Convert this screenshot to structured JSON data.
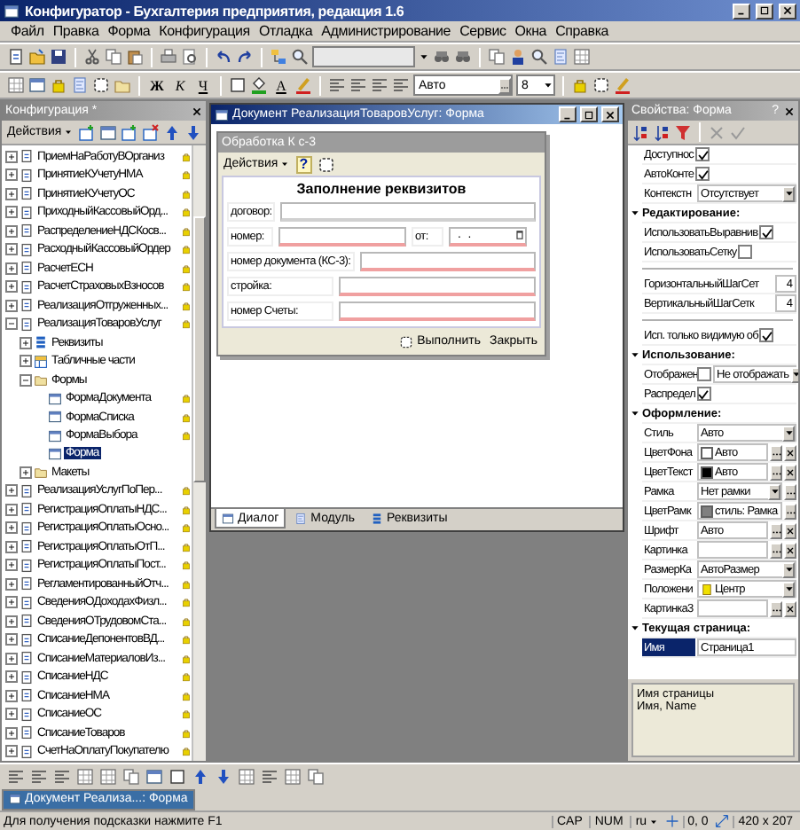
{
  "window": {
    "title": "Конфигуратор - Бухгалтерия предприятия, редакция 1.6"
  },
  "menu": [
    "Файл",
    "Правка",
    "Форма",
    "Конфигурация",
    "Отладка",
    "Администрирование",
    "Сервис",
    "Окна",
    "Справка"
  ],
  "format_toolbar": {
    "bold": "Ж",
    "italic": "К",
    "underline": "Ч",
    "text_color": "A",
    "font": "Авто",
    "size": "8"
  },
  "config_panel": {
    "title": "Конфигурация *",
    "actions": "Действия",
    "tree": [
      {
        "label": "ПриемНаРаботуВОрганиз",
        "kind": "document",
        "expanded": false,
        "selected": false,
        "captured": true
      },
      {
        "label": "ПринятиеКУчетуНМА",
        "kind": "document",
        "expanded": false,
        "selected": false,
        "captured": true
      },
      {
        "label": "ПринятиеКУчетуОС",
        "kind": "document",
        "expanded": false,
        "selected": false,
        "captured": true
      },
      {
        "label": "ПриходныйКассовыйОрд...",
        "kind": "document",
        "expanded": false,
        "selected": false,
        "captured": true
      },
      {
        "label": "РаспределениеНДСКосв...",
        "kind": "document",
        "expanded": false,
        "selected": false,
        "captured": true
      },
      {
        "label": "РасходныйКассовыйОрдер",
        "kind": "document",
        "expanded": false,
        "selected": false,
        "captured": true
      },
      {
        "label": "РасчетЕСН",
        "kind": "document",
        "expanded": false,
        "selected": false,
        "captured": true
      },
      {
        "label": "РасчетСтраховыхВзносов",
        "kind": "document",
        "expanded": false,
        "selected": false,
        "captured": true
      },
      {
        "label": "РеализацияОтгруженных...",
        "kind": "document",
        "expanded": false,
        "selected": false,
        "captured": true
      },
      {
        "label": "РеализацияТоваровУслуг",
        "kind": "document",
        "expanded": true,
        "selected": false,
        "captured": true,
        "children": [
          {
            "label": "Реквизиты",
            "kind": "attributes",
            "expanded": false,
            "selected": false,
            "captured": false
          },
          {
            "label": "Табличные части",
            "kind": "tables",
            "expanded": false,
            "selected": false,
            "captured": false
          },
          {
            "label": "Формы",
            "kind": "forms",
            "expanded": true,
            "selected": false,
            "captured": false,
            "children": [
              {
                "label": "ФормаДокумента",
                "kind": "form",
                "selected": false,
                "captured": true
              },
              {
                "label": "ФормаСписка",
                "kind": "form",
                "selected": false,
                "captured": true
              },
              {
                "label": "ФормаВыбора",
                "kind": "form",
                "selected": false,
                "captured": true
              },
              {
                "label": "Форма",
                "kind": "form",
                "selected": true,
                "captured": false
              }
            ]
          },
          {
            "label": "Макеты",
            "kind": "templates",
            "expanded": false,
            "selected": false,
            "captured": false
          }
        ]
      },
      {
        "label": "РеализацияУслугПоПер...",
        "kind": "document",
        "expanded": false,
        "selected": false,
        "captured": true
      },
      {
        "label": "РегистрацияОплатыНДС...",
        "kind": "document",
        "expanded": false,
        "selected": false,
        "captured": true
      },
      {
        "label": "РегистрацияОплатыОсно...",
        "kind": "document",
        "expanded": false,
        "selected": false,
        "captured": true
      },
      {
        "label": "РегистрацияОплатыОтП...",
        "kind": "document",
        "expanded": false,
        "selected": false,
        "captured": true
      },
      {
        "label": "РегистрацияОплатыПост...",
        "kind": "document",
        "expanded": false,
        "selected": false,
        "captured": true
      },
      {
        "label": "РегламентированныйОтч...",
        "kind": "document",
        "expanded": false,
        "selected": false,
        "captured": true
      },
      {
        "label": "СведенияОДоходахФизл...",
        "kind": "document",
        "expanded": false,
        "selected": false,
        "captured": true
      },
      {
        "label": "СведенияОТрудовомСта...",
        "kind": "document",
        "expanded": false,
        "selected": false,
        "captured": true
      },
      {
        "label": "СписаниеДепонентовВД...",
        "kind": "document",
        "expanded": false,
        "selected": false,
        "captured": true
      },
      {
        "label": "СписаниеМатериаловИз...",
        "kind": "document",
        "expanded": false,
        "selected": false,
        "captured": true
      },
      {
        "label": "СписаниеНДС",
        "kind": "document",
        "expanded": false,
        "selected": false,
        "captured": true
      },
      {
        "label": "СписаниеНМА",
        "kind": "document",
        "expanded": false,
        "selected": false,
        "captured": true
      },
      {
        "label": "СписаниеОС",
        "kind": "document",
        "expanded": false,
        "selected": false,
        "captured": true
      },
      {
        "label": "СписаниеТоваров",
        "kind": "document",
        "expanded": false,
        "selected": false,
        "captured": true
      },
      {
        "label": "СчетНаОплатуПокупателю",
        "kind": "document",
        "expanded": false,
        "selected": false,
        "captured": true
      }
    ]
  },
  "form_window": {
    "title": "Документ РеализацияТоваровУслуг: Форма",
    "form": {
      "title": "Обработка К с-3",
      "actions": "Действия",
      "help": "?",
      "heading": "Заполнение реквизитов",
      "rows": [
        [
          {
            "label": "договор:",
            "kind": "text",
            "required": false
          }
        ],
        [
          {
            "label": "номер:",
            "kind": "text",
            "required": true
          },
          {
            "label": "от:",
            "kind": "date",
            "value": " .  . ",
            "required": true
          }
        ],
        [
          {
            "label": "номер документа (КС-3):",
            "kind": "text",
            "required": true
          }
        ],
        [
          {
            "label": "стройка:",
            "kind": "text",
            "required": true
          }
        ],
        [
          {
            "label": "номер Счеты:",
            "kind": "text",
            "required": true
          }
        ]
      ],
      "buttons": [
        "Выполнить",
        "Закрыть"
      ]
    },
    "tabs": [
      {
        "label": "Диалог",
        "selected": true
      },
      {
        "label": "Модуль",
        "selected": false
      },
      {
        "label": "Реквизиты",
        "selected": false
      }
    ]
  },
  "properties": {
    "title": "Свойства: Форма",
    "help": "?",
    "rows": [
      {
        "kind": "check",
        "label": "Доступнос",
        "checked": true
      },
      {
        "kind": "check",
        "label": "АвтоКонте",
        "checked": true
      },
      {
        "kind": "field",
        "label": "Контекстн",
        "value": "Отсутствует",
        "dropdown": true,
        "ellipsis": false,
        "clear": false
      },
      {
        "kind": "section",
        "label": "Редактирование:",
        "expanded": true
      },
      {
        "kind": "check",
        "label": "ИспользоватьВыравнив",
        "checked": true
      },
      {
        "kind": "check",
        "label": "ИспользоватьСетку",
        "checked": false
      },
      {
        "kind": "separator"
      },
      {
        "kind": "number",
        "label": "ГоризонтальныйШагСет",
        "value": "4"
      },
      {
        "kind": "number",
        "label": "ВертикальныйШагСетк",
        "value": "4"
      },
      {
        "kind": "separator"
      },
      {
        "kind": "check",
        "label": "Исп. только видимую об",
        "checked": true
      },
      {
        "kind": "section",
        "label": "Использование:",
        "expanded": true
      },
      {
        "kind": "checkfield",
        "label": "Отображен",
        "checked": false,
        "value": "Не отображать",
        "dropdown": true
      },
      {
        "kind": "check",
        "label": "Распредел",
        "checked": true
      },
      {
        "kind": "section",
        "label": "Оформление:",
        "expanded": true
      },
      {
        "kind": "field",
        "label": "Стиль",
        "value": "Авто",
        "dropdown": true,
        "ellipsis": false,
        "clear": false
      },
      {
        "kind": "field",
        "label": "ЦветФона",
        "value": "Авто",
        "color": "#ffffff",
        "dropdown": false,
        "ellipsis": true,
        "clear": true
      },
      {
        "kind": "field",
        "label": "ЦветТекст",
        "value": "Авто",
        "color": "#000000",
        "dropdown": false,
        "ellipsis": true,
        "clear": true
      },
      {
        "kind": "field",
        "label": "Рамка",
        "value": "Нет рамки",
        "dropdown": true,
        "ellipsis": true,
        "clear": false
      },
      {
        "kind": "field",
        "label": "ЦветРамк",
        "value": "стиль: Рамка",
        "color": "#808080",
        "dropdown": false,
        "ellipsis": true,
        "clear": false
      },
      {
        "kind": "field",
        "label": "Шрифт",
        "value": "Авто",
        "dropdown": false,
        "ellipsis": true,
        "clear": true
      },
      {
        "kind": "field",
        "label": "Картинка",
        "dropdown": false,
        "ellipsis": true,
        "clear": true
      },
      {
        "kind": "field",
        "label": "РазмерКа",
        "value": "АвтоРазмер",
        "dropdown": true,
        "ellipsis": false,
        "clear": false
      },
      {
        "kind": "field",
        "label": "Положени",
        "value": "Центр",
        "position_icon": true,
        "dropdown": true,
        "ellipsis": false,
        "clear": false
      },
      {
        "kind": "field",
        "label": "Картинка3",
        "dropdown": false,
        "ellipsis": true,
        "clear": true
      },
      {
        "kind": "section",
        "label": "Текущая страница:",
        "expanded": true
      },
      {
        "kind": "field",
        "label": "Имя",
        "value": "Страница1",
        "selected": true,
        "dropdown": false,
        "ellipsis": false,
        "clear": false
      }
    ],
    "description": [
      "Имя страницы",
      "Имя, Name"
    ]
  },
  "taskbar": [
    {
      "label": "Документ Реализа...: Форма",
      "selected": true
    }
  ],
  "status_bar": {
    "hint": "Для получения подсказки нажмите F1",
    "indicators": [
      "CAP",
      "NUM"
    ],
    "language": "ru",
    "position": "0, 0",
    "size": "420 x 207"
  }
}
